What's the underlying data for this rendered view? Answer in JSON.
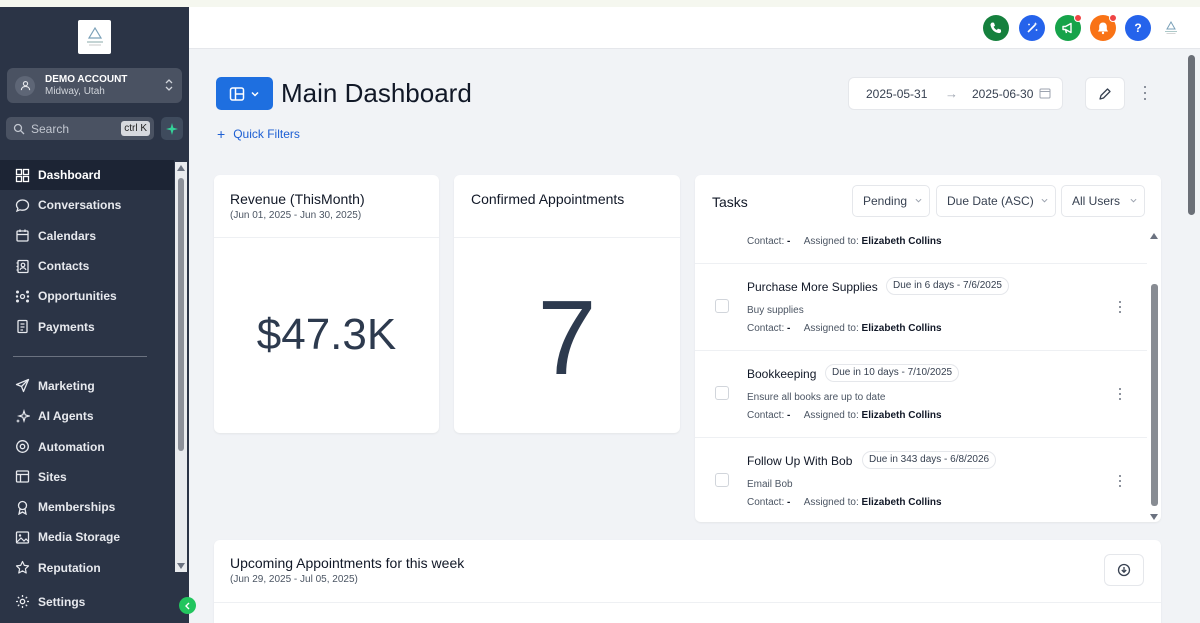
{
  "sidebar": {
    "account": {
      "name": "DEMO ACCOUNT",
      "location": "Midway, Utah"
    },
    "search": {
      "placeholder": "Search",
      "shortcut": "ctrl K"
    },
    "nav": [
      {
        "label": "Dashboard",
        "icon": "dashboard-icon",
        "active": true
      },
      {
        "label": "Conversations",
        "icon": "chat-icon"
      },
      {
        "label": "Calendars",
        "icon": "calendar-icon"
      },
      {
        "label": "Contacts",
        "icon": "contacts-icon"
      },
      {
        "label": "Opportunities",
        "icon": "opportunities-icon"
      },
      {
        "label": "Payments",
        "icon": "payments-icon"
      }
    ],
    "nav2": [
      {
        "label": "Marketing",
        "icon": "send-icon"
      },
      {
        "label": "AI Agents",
        "icon": "sparkle-icon"
      },
      {
        "label": "Automation",
        "icon": "automation-icon"
      },
      {
        "label": "Sites",
        "icon": "sites-icon"
      },
      {
        "label": "Memberships",
        "icon": "membership-icon"
      },
      {
        "label": "Media Storage",
        "icon": "media-icon"
      },
      {
        "label": "Reputation",
        "icon": "star-icon"
      }
    ],
    "settings_label": "Settings"
  },
  "topbar": {
    "buttons": [
      {
        "icon": "phone-icon",
        "color": "#15803d"
      },
      {
        "icon": "magic-icon",
        "color": "#2563eb"
      },
      {
        "icon": "megaphone-icon",
        "color": "#16a34a"
      },
      {
        "icon": "bell-icon",
        "color": "#f97316"
      },
      {
        "icon": "help-icon",
        "color": "#2563eb"
      }
    ]
  },
  "header": {
    "title": "Main Dashboard",
    "quick_filters": "Quick Filters",
    "date_start": "2025-05-31",
    "date_end": "2025-06-30"
  },
  "revenue": {
    "title": "Revenue (ThisMonth)",
    "range": "(Jun 01, 2025 - Jun 30, 2025)",
    "value": "$47.3K"
  },
  "confirmed": {
    "title": "Confirmed Appointments",
    "value": "7"
  },
  "tasks": {
    "title": "Tasks",
    "filters": {
      "status": "Pending",
      "sort": "Due Date (ASC)",
      "users": "All Users"
    },
    "contact_label": "Contact:",
    "contact_value": "-",
    "assigned_label": "Assigned to:",
    "partial_assigned": "Elizabeth Collins",
    "items": [
      {
        "title": "Purchase More Supplies",
        "due": "Due in 6 days - 7/6/2025",
        "desc": "Buy supplies",
        "assigned": "Elizabeth Collins"
      },
      {
        "title": "Bookkeeping",
        "due": "Due in 10 days - 7/10/2025",
        "desc": "Ensure all books are up to date",
        "assigned": "Elizabeth Collins"
      },
      {
        "title": "Follow Up With Bob",
        "due": "Due in 343 days - 6/8/2026",
        "desc": "Email Bob",
        "assigned": "Elizabeth Collins"
      }
    ]
  },
  "upcoming": {
    "title": "Upcoming Appointments for this week",
    "range": "(Jun 29, 2025 - Jul 05, 2025)"
  }
}
